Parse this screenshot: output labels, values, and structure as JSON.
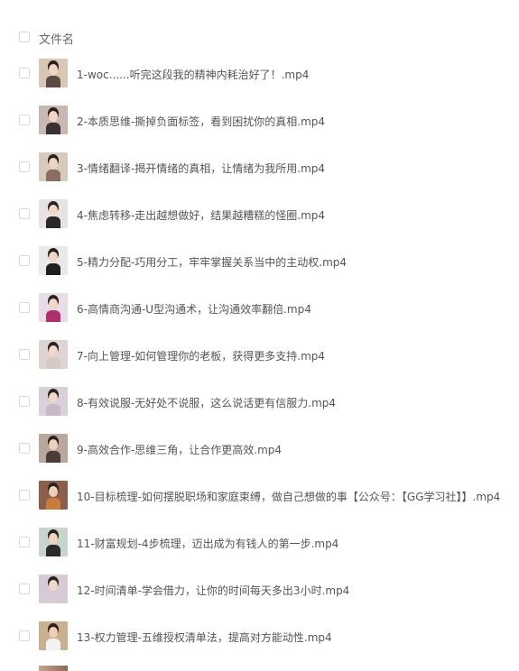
{
  "header": {
    "column_label": "文件名",
    "partial_top_text": "— — — — — — — — — — — — — — —"
  },
  "files": [
    {
      "name": "1-woc......听完这段我的精神内耗治好了！.mp4",
      "thumb": {
        "bg": "#d9c6b5",
        "skin": "#f0d6c4",
        "cloth": "#5a4a44"
      }
    },
    {
      "name": "2-本质思维-撕掉负面标签，看到困扰你的真相.mp4",
      "thumb": {
        "bg": "#c9b7b1",
        "skin": "#f2d5c6",
        "cloth": "#3b2f33"
      }
    },
    {
      "name": "3-情绪翻译-揭开情绪的真相，让情绪为我所用.mp4",
      "thumb": {
        "bg": "#d8c9bd",
        "skin": "#efd4c2",
        "cloth": "#8a6e62"
      }
    },
    {
      "name": "4-焦虑转移-走出越想做好，结果越糟糕的怪圈.mp4",
      "thumb": {
        "bg": "#e7e3e2",
        "skin": "#f0d7c8",
        "cloth": "#2d2628"
      }
    },
    {
      "name": "5-精力分配-巧用分工，牢牢掌握关系当中的主动权.mp4",
      "thumb": {
        "bg": "#e9e9e9",
        "skin": "#efd6c5",
        "cloth": "#1f1f1f"
      }
    },
    {
      "name": "6-高情商沟通-U型沟通术，让沟通效率翻倍.mp4",
      "thumb": {
        "bg": "#e8dde7",
        "skin": "#f1d6c7",
        "cloth": "#b0306f"
      }
    },
    {
      "name": "7-向上管理-如何管理你的老板，获得更多支持.mp4",
      "thumb": {
        "bg": "#ded5d3",
        "skin": "#f2d8c9",
        "cloth": "#d7c9c3"
      }
    },
    {
      "name": "8-有效说服-无好处不说服，这么说话更有信服力.mp4",
      "thumb": {
        "bg": "#d9d0d9",
        "skin": "#f1d6c6",
        "cloth": "#c9b9c8"
      }
    },
    {
      "name": "9-高效合作-思维三角，让合作更高效.mp4",
      "thumb": {
        "bg": "#b8a89c",
        "skin": "#ecd0bd",
        "cloth": "#4a3c36"
      }
    },
    {
      "name": "10-目标梳理-如何摆脱职场和家庭束缚，做自己想做的事【公众号：【GG学习社】】.mp4",
      "thumb": {
        "bg": "#8c5e4c",
        "skin": "#f0cfb8",
        "cloth": "#c87d3c"
      }
    },
    {
      "name": "11-财富规划-4步梳理，迈出成为有钱人的第一步.mp4",
      "thumb": {
        "bg": "#c8d4cc",
        "skin": "#f0d3c2",
        "cloth": "#2b2b2b"
      }
    },
    {
      "name": "12-时间清单-学会借力，让你的时间每天多出3小时.mp4",
      "thumb": {
        "bg": "#d6cad6",
        "skin": "#f1d7c8",
        "cloth": "#d9cbd6"
      }
    },
    {
      "name": "13-权力管理-五维授权清单法，提高对方能动性.mp4",
      "thumb": {
        "bg": "#c9b08e",
        "skin": "#efcfb6",
        "cloth": "#f2f2f2"
      }
    }
  ]
}
